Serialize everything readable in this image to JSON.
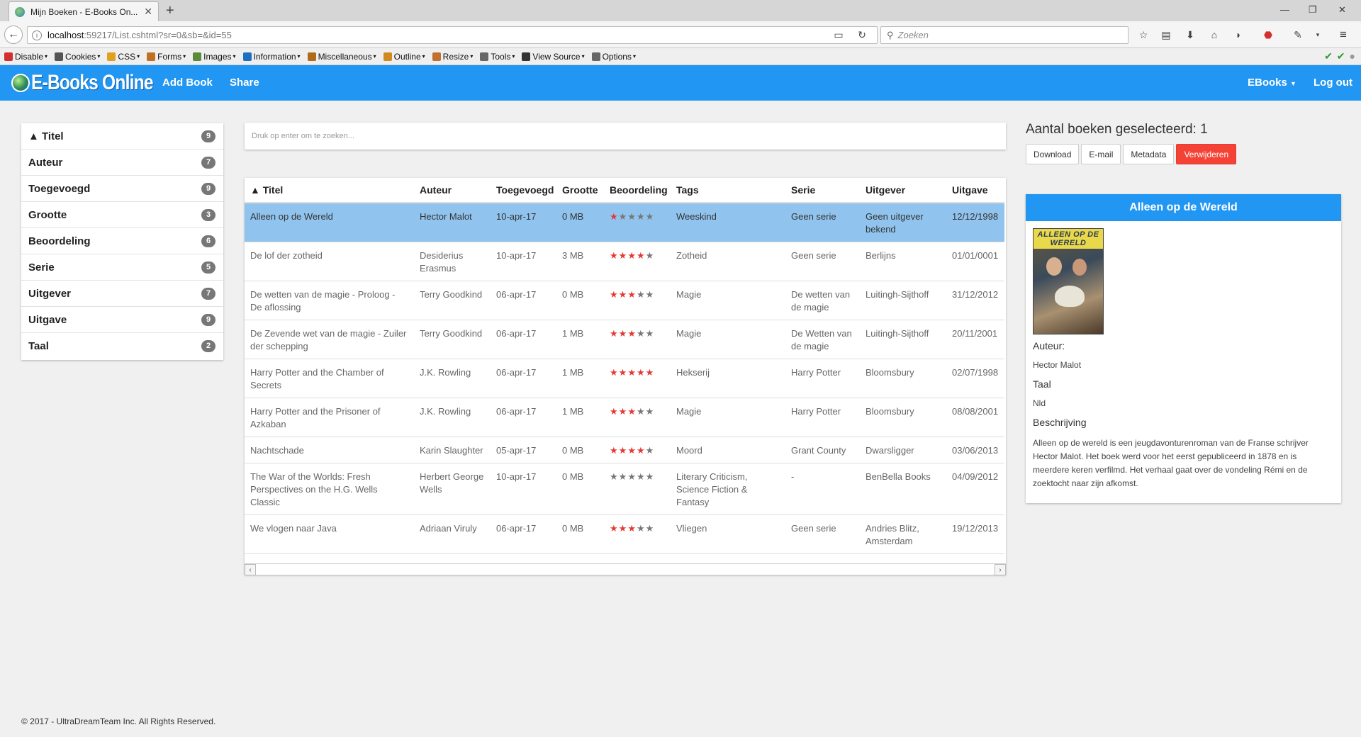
{
  "browser": {
    "tab_title": "Mijn Boeken - E-Books On...",
    "url_host": "localhost",
    "url_path": ":59217/List.cshtml?sr=0&sb=&id=55",
    "search_placeholder": "Zoeken",
    "devbar": [
      {
        "label": "Disable",
        "icon": "disable-icon",
        "color": "#d32f2f"
      },
      {
        "label": "Cookies",
        "icon": "cookies-icon",
        "color": "#555555"
      },
      {
        "label": "CSS",
        "icon": "css-icon",
        "color": "#e0a020"
      },
      {
        "label": "Forms",
        "icon": "forms-icon",
        "color": "#c07020"
      },
      {
        "label": "Images",
        "icon": "images-icon",
        "color": "#5a8a3a"
      },
      {
        "label": "Information",
        "icon": "information-icon",
        "color": "#1e6fc0"
      },
      {
        "label": "Miscellaneous",
        "icon": "miscellaneous-icon",
        "color": "#b06a1a"
      },
      {
        "label": "Outline",
        "icon": "outline-icon",
        "color": "#d08a20"
      },
      {
        "label": "Resize",
        "icon": "resize-icon",
        "color": "#c07030"
      },
      {
        "label": "Tools",
        "icon": "tools-icon",
        "color": "#666666"
      },
      {
        "label": "View Source",
        "icon": "view-source-icon",
        "color": "#333333"
      },
      {
        "label": "Options",
        "icon": "options-icon",
        "color": "#666666"
      }
    ]
  },
  "app": {
    "brand": "E-Books Online",
    "nav_add": "Add Book",
    "nav_share": "Share",
    "nav_ebooks": "EBooks",
    "nav_logout": "Log out",
    "accent": "#2196f3"
  },
  "sidebar": {
    "items": [
      {
        "label": "▲ Titel",
        "count": "9"
      },
      {
        "label": "Auteur",
        "count": "7"
      },
      {
        "label": "Toegevoegd",
        "count": "9"
      },
      {
        "label": "Grootte",
        "count": "3"
      },
      {
        "label": "Beoordeling",
        "count": "6"
      },
      {
        "label": "Serie",
        "count": "5"
      },
      {
        "label": "Uitgever",
        "count": "7"
      },
      {
        "label": "Uitgave",
        "count": "9"
      },
      {
        "label": "Taal",
        "count": "2"
      }
    ]
  },
  "search": {
    "placeholder": "Druk op enter om te zoeken..."
  },
  "table": {
    "headers": [
      "▲ Titel",
      "Auteur",
      "Toegevoegd",
      "Grootte",
      "Beoordeling",
      "Tags",
      "Serie",
      "Uitgever",
      "Uitgave"
    ],
    "rows": [
      {
        "titel": "Alleen op de Wereld",
        "auteur": "Hector Malot",
        "toegevoegd": "10-apr-17",
        "grootte": "0 MB",
        "rating": 1,
        "tags": "Weeskind",
        "serie": "Geen serie",
        "uitgever": "Geen uitgever bekend",
        "uitgave": "12/12/1998",
        "selected": true
      },
      {
        "titel": "De lof der zotheid",
        "auteur": "Desiderius Erasmus",
        "toegevoegd": "10-apr-17",
        "grootte": "3 MB",
        "rating": 4,
        "tags": "Zotheid",
        "serie": "Geen serie",
        "uitgever": "Berlijns",
        "uitgave": "01/01/0001",
        "selected": false
      },
      {
        "titel": "De wetten van de magie - Proloog - De aflossing",
        "auteur": "Terry Goodkind",
        "toegevoegd": "06-apr-17",
        "grootte": "0 MB",
        "rating": 3,
        "tags": "Magie",
        "serie": "De wetten van de magie",
        "uitgever": "Luitingh-Sijthoff",
        "uitgave": "31/12/2012",
        "selected": false
      },
      {
        "titel": "De Zevende wet van de magie - Zuiler der schepping",
        "auteur": "Terry Goodkind",
        "toegevoegd": "06-apr-17",
        "grootte": "1 MB",
        "rating": 3,
        "tags": "Magie",
        "serie": "De Wetten van de magie",
        "uitgever": "Luitingh-Sijthoff",
        "uitgave": "20/11/2001",
        "selected": false
      },
      {
        "titel": "Harry Potter and the Chamber of Secrets",
        "auteur": "J.K. Rowling",
        "toegevoegd": "06-apr-17",
        "grootte": "1 MB",
        "rating": 5,
        "tags": "Hekserij",
        "serie": "Harry Potter",
        "uitgever": "Bloomsbury",
        "uitgave": "02/07/1998",
        "selected": false
      },
      {
        "titel": "Harry Potter and the Prisoner of Azkaban",
        "auteur": "J.K. Rowling",
        "toegevoegd": "06-apr-17",
        "grootte": "1 MB",
        "rating": 3,
        "tags": "Magie",
        "serie": "Harry Potter",
        "uitgever": "Bloomsbury",
        "uitgave": "08/08/2001",
        "selected": false
      },
      {
        "titel": "Nachtschade",
        "auteur": "Karin Slaughter",
        "toegevoegd": "05-apr-17",
        "grootte": "0 MB",
        "rating": 4,
        "tags": "Moord",
        "serie": "Grant County",
        "uitgever": "Dwarsligger",
        "uitgave": "03/06/2013",
        "selected": false
      },
      {
        "titel": "The War of the Worlds: Fresh Perspectives on the H.G. Wells Classic",
        "auteur": "Herbert George Wells",
        "toegevoegd": "10-apr-17",
        "grootte": "0 MB",
        "rating": 0,
        "tags": "Literary Criticism, Science Fiction & Fantasy",
        "serie": "-",
        "uitgever": "BenBella Books",
        "uitgave": "04/09/2012",
        "selected": false
      },
      {
        "titel": "We vlogen naar Java",
        "auteur": "Adriaan Viruly",
        "toegevoegd": "06-apr-17",
        "grootte": "0 MB",
        "rating": 3,
        "tags": "Vliegen",
        "serie": "Geen serie",
        "uitgever": "Andries Blitz, Amsterdam",
        "uitgave": "19/12/2013",
        "selected": false
      }
    ]
  },
  "selection": {
    "count_text": "Aantal boeken geselecteerd: 1",
    "btn_download": "Download",
    "btn_email": "E-mail",
    "btn_metadata": "Metadata",
    "btn_delete": "Verwijderen"
  },
  "detail": {
    "title": "Alleen op de Wereld",
    "cover_text": "ALLEEN OP DE WERELD",
    "author_label": "Auteur:",
    "author": "Hector Malot",
    "lang_label": "Taal",
    "lang": "Nld",
    "desc_label": "Beschrijving",
    "desc": "Alleen op de wereld is een jeugdavonturenroman van de Franse schrijver Hector Malot. Het boek werd voor het eerst gepubliceerd in 1878 en is meerdere keren verfilmd. Het verhaal gaat over de vondeling Rémi en de zoektocht naar zijn afkomst."
  },
  "footer": {
    "text": "© 2017 - UltraDreamTeam Inc. All Rights Reserved."
  }
}
